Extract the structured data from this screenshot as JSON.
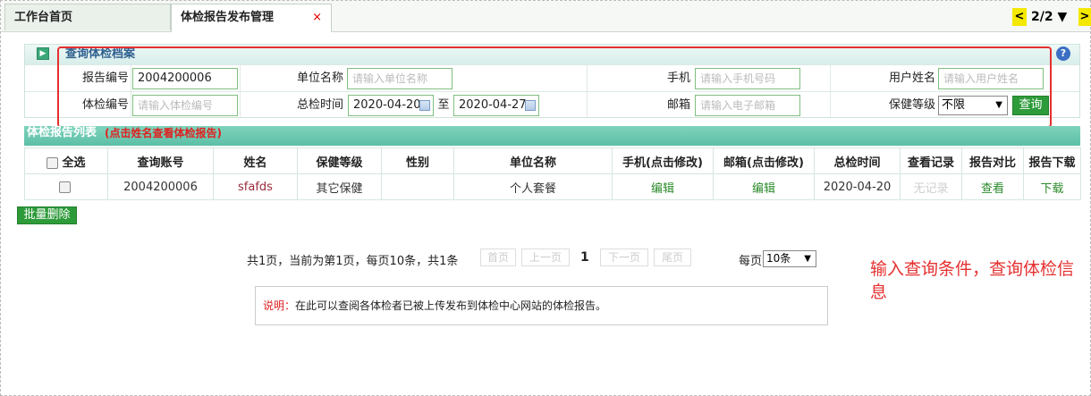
{
  "tabs": [
    {
      "label": "工作台首页"
    },
    {
      "label": "体检报告发布管理",
      "close": "×"
    }
  ],
  "tab_nav": {
    "prev": "<",
    "counter": "2/2 ▼",
    "next": ">"
  },
  "search": {
    "title": "查询体检档案",
    "fields": {
      "report_no": {
        "label": "报告编号",
        "value": "2004200006"
      },
      "unit_name": {
        "label": "单位名称",
        "placeholder": "请输入单位名称"
      },
      "phone": {
        "label": "手机",
        "placeholder": "请输入手机号码"
      },
      "user_name": {
        "label": "用户姓名",
        "placeholder": "请输入用户姓名"
      },
      "exam_no": {
        "label": "体检编号",
        "placeholder": "请输入体检编号"
      },
      "exam_time": {
        "label": "总检时间",
        "from": "2020-04-20",
        "sep": "至",
        "to": "2020-04-27"
      },
      "email": {
        "label": "邮箱",
        "placeholder": "请输入电子邮箱"
      },
      "care_level": {
        "label": "保健等级",
        "value": "不限"
      }
    },
    "query_button": "查询"
  },
  "list": {
    "title": "体检报告列表",
    "hint": "(点击姓名查看体检报告)",
    "columns": [
      "全选",
      "查询账号",
      "姓名",
      "保健等级",
      "性别",
      "单位名称",
      "手机(点击修改)",
      "邮箱(点击修改)",
      "总检时间",
      "查看记录",
      "报告对比",
      "报告下载"
    ],
    "rows": [
      {
        "account": "2004200006",
        "name": "sfafds",
        "level": "其它保健",
        "gender": "",
        "unit": "个人套餐",
        "phone": "编辑",
        "email": "编辑",
        "time": "2020-04-20",
        "records": "无记录",
        "compare": "查看",
        "download": "下载"
      }
    ]
  },
  "batch_delete": "批量删除",
  "pagination": {
    "info": "共1页，当前为第1页，每页10条，共1条",
    "first": "首页",
    "prev": "上一页",
    "current": "1",
    "next": "下一页",
    "last": "尾页",
    "size_label": "每页",
    "size_value": "10条"
  },
  "note": {
    "key": "说明：",
    "text": "在此可以查阅各体检者已被上传发布到体检中心网站的体检报告。"
  },
  "annotation": "输入查询条件，查询体检信息",
  "colors": {
    "accent_green": "#2e9b3a",
    "header_teal": "#5cbfa6",
    "highlight_red": "#e53030"
  }
}
